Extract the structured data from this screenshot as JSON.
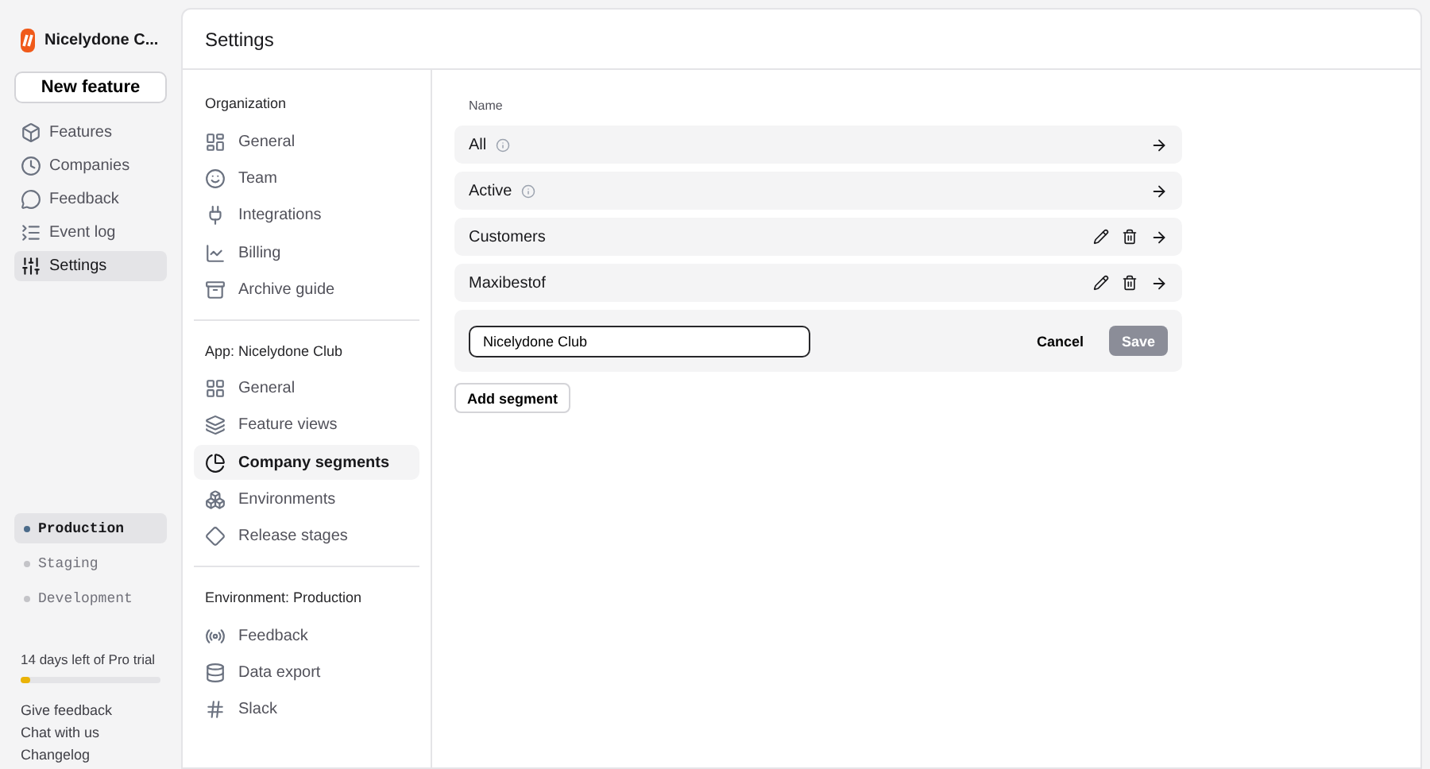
{
  "workspace": {
    "name": "Nicelydone C..."
  },
  "new_feature_button": "New feature",
  "sidebar": {
    "items": [
      {
        "label": "Features",
        "kind": "box",
        "selected": false
      },
      {
        "label": "Companies",
        "kind": "clock",
        "selected": false
      },
      {
        "label": "Feedback",
        "kind": "message",
        "selected": false
      },
      {
        "label": "Event log",
        "kind": "log",
        "selected": false
      },
      {
        "label": "Settings",
        "kind": "sliders",
        "selected": true
      }
    ]
  },
  "environments": [
    {
      "label": "Production",
      "selected": true
    },
    {
      "label": "Staging",
      "selected": false
    },
    {
      "label": "Development",
      "selected": false
    }
  ],
  "trial": {
    "text": "14 days left of Pro trial",
    "level": 0.07
  },
  "footer_links": [
    "Give feedback",
    "Chat with us",
    "Changelog"
  ],
  "page_title": "Settings",
  "settings_nav": [
    {
      "heading": "Organization",
      "items": [
        {
          "label": "General",
          "kind": "dashboard",
          "selected": false
        },
        {
          "label": "Team",
          "kind": "smile",
          "selected": false
        },
        {
          "label": "Integrations",
          "kind": "plug",
          "selected": false
        },
        {
          "label": "Billing",
          "kind": "chart",
          "selected": false
        },
        {
          "label": "Archive guide",
          "kind": "archive",
          "selected": false
        }
      ]
    },
    {
      "heading": "App: Nicelydone Club",
      "items": [
        {
          "label": "General",
          "kind": "grid",
          "selected": false
        },
        {
          "label": "Feature views",
          "kind": "layers",
          "selected": false
        },
        {
          "label": "Company segments",
          "kind": "pie",
          "selected": true
        },
        {
          "label": "Environments",
          "kind": "boxes",
          "selected": false
        },
        {
          "label": "Release stages",
          "kind": "diamond",
          "selected": false
        }
      ]
    },
    {
      "heading": "Environment: Production",
      "items": [
        {
          "label": "Feedback",
          "kind": "radio",
          "selected": false
        },
        {
          "label": "Data export",
          "kind": "database",
          "selected": false
        },
        {
          "label": "Slack",
          "kind": "hash",
          "selected": false
        }
      ]
    }
  ],
  "segments": {
    "column": "Name",
    "rows": [
      {
        "name": "All",
        "kind": "system"
      },
      {
        "name": "Active",
        "kind": "system"
      },
      {
        "name": "Customers",
        "kind": "custom"
      },
      {
        "name": "Maxibestof",
        "kind": "custom"
      }
    ],
    "editor": {
      "value": "Nicelydone Club",
      "cancel": "Cancel",
      "save": "Save",
      "save_disabled": true
    },
    "add_button": "Add segment"
  }
}
